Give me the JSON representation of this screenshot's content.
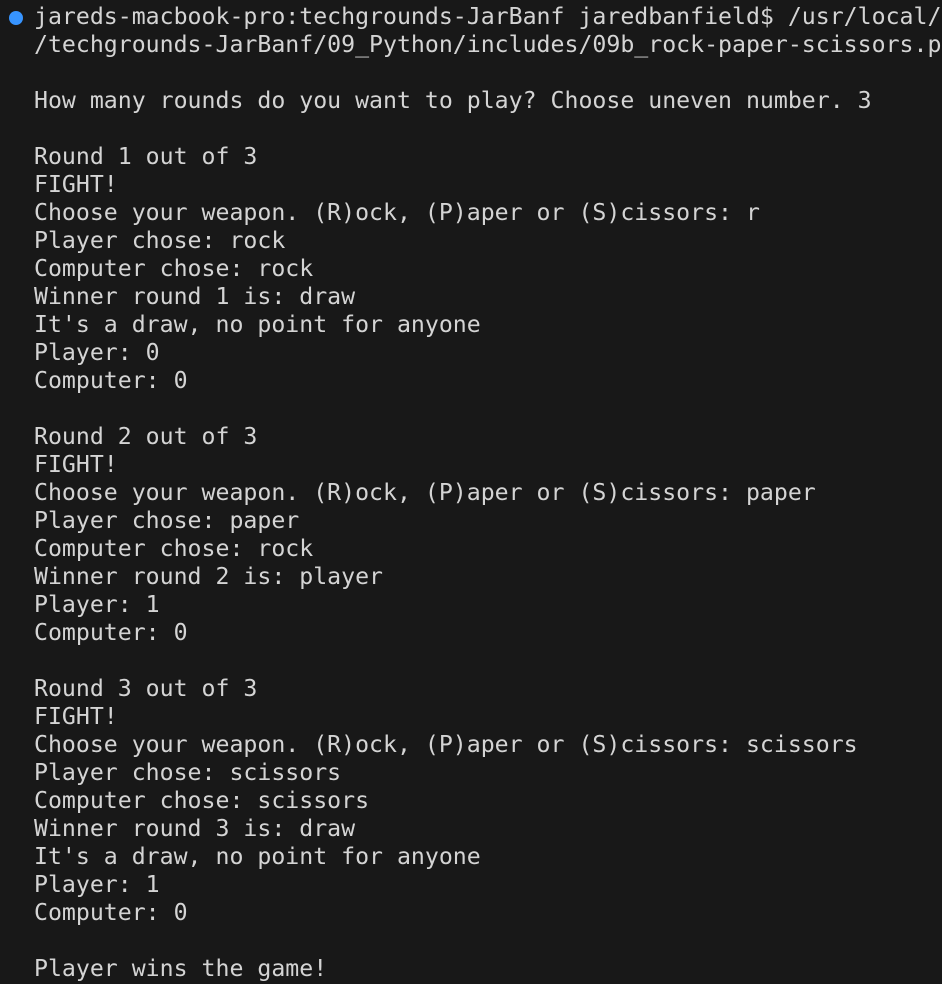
{
  "terminal": {
    "status_dot_color": "#3794ff",
    "text_color": "#d4d4d4",
    "background": "#181818",
    "lines": [
      "jareds-macbook-pro:techgrounds-JarBanf jaredbanfield$ /usr/local/",
      "/techgrounds-JarBanf/09_Python/includes/09b_rock-paper-scissors.p",
      "",
      "How many rounds do you want to play? Choose uneven number. 3",
      "",
      "Round 1 out of 3",
      "FIGHT!",
      "Choose your weapon. (R)ock, (P)aper or (S)cissors: r",
      "Player chose: rock",
      "Computer chose: rock",
      "Winner round 1 is: draw",
      "It's a draw, no point for anyone",
      "Player: 0",
      "Computer: 0",
      "",
      "Round 2 out of 3",
      "FIGHT!",
      "Choose your weapon. (R)ock, (P)aper or (S)cissors: paper",
      "Player chose: paper",
      "Computer chose: rock",
      "Winner round 2 is: player",
      "Player: 1",
      "Computer: 0",
      "",
      "Round 3 out of 3",
      "FIGHT!",
      "Choose your weapon. (R)ock, (P)aper or (S)cissors: scissors",
      "Player chose: scissors",
      "Computer chose: scissors",
      "Winner round 3 is: draw",
      "It's a draw, no point for anyone",
      "Player: 1",
      "Computer: 0",
      "",
      "Player wins the game!"
    ]
  }
}
